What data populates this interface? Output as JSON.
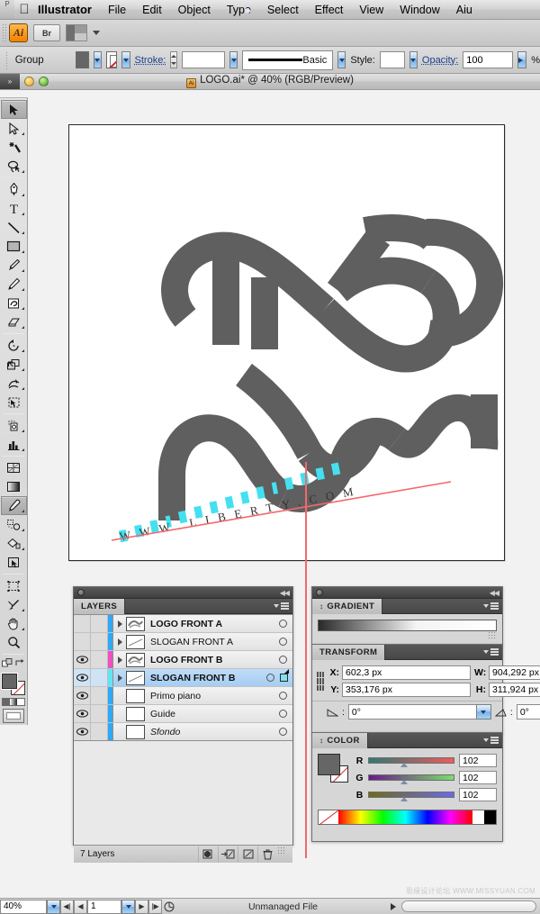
{
  "menubar": {
    "corner_label": "P",
    "apple_icon": "apple-logo",
    "items": [
      {
        "label": "Illustrator",
        "bold": true
      },
      {
        "label": "File"
      },
      {
        "label": "Edit"
      },
      {
        "label": "Object"
      },
      {
        "label": "Type"
      },
      {
        "label": "Select"
      },
      {
        "label": "Effect"
      },
      {
        "label": "View"
      },
      {
        "label": "Window"
      },
      {
        "label": "Aiu"
      }
    ]
  },
  "approw": {
    "ai_badge": "Ai",
    "bridge_label": "Br",
    "arrange_icon": "arrange-documents-icon",
    "dropdown_icon": "chevron-down-icon"
  },
  "controlbar": {
    "selection_label": "Group",
    "fill_swatch_color": "#666666",
    "stroke_label": "Stroke:",
    "stroke_weight": "",
    "stroke_profile": "Basic",
    "style_label": "Style:",
    "opacity_label": "Opacity:",
    "opacity_value": "100",
    "opacity_unit": "%"
  },
  "titlebar": {
    "title": "LOGO.ai* @ 40% (RGB/Preview)",
    "doc_icon": "Ai",
    "close_button": "yellow-minimize-dot",
    "zoom_button": "green-zoom-dot"
  },
  "toolbox": {
    "tools": [
      {
        "name": "selection-tool",
        "selected": true
      },
      {
        "name": "direct-selection-tool",
        "selected": false
      },
      {
        "name": "magic-wand-tool",
        "selected": false
      },
      {
        "name": "lasso-tool",
        "selected": false
      },
      {
        "name": "pen-tool",
        "selected": false
      },
      {
        "name": "type-tool",
        "selected": false
      },
      {
        "name": "line-segment-tool",
        "selected": false
      },
      {
        "name": "rectangle-tool",
        "selected": false
      },
      {
        "name": "paintbrush-tool",
        "selected": false
      },
      {
        "name": "pencil-tool",
        "selected": false
      },
      {
        "name": "blob-brush-tool",
        "selected": false
      },
      {
        "name": "eraser-tool",
        "selected": false
      },
      {
        "name": "rotate-tool",
        "selected": false
      },
      {
        "name": "scale-tool",
        "selected": false
      },
      {
        "name": "warp-tool",
        "selected": false
      },
      {
        "name": "free-transform-tool",
        "selected": false
      },
      {
        "name": "symbol-sprayer-tool",
        "selected": false
      },
      {
        "name": "column-graph-tool",
        "selected": false
      },
      {
        "name": "mesh-tool",
        "selected": false
      },
      {
        "name": "gradient-tool",
        "selected": false
      },
      {
        "name": "eyedropper-tool",
        "selected": true
      },
      {
        "name": "blend-tool",
        "selected": false
      },
      {
        "name": "live-paint-bucket-tool",
        "selected": false
      },
      {
        "name": "live-paint-selection-tool",
        "selected": false
      },
      {
        "name": "artboard-tool",
        "selected": false
      },
      {
        "name": "slice-tool",
        "selected": false
      },
      {
        "name": "hand-tool",
        "selected": false
      },
      {
        "name": "zoom-tool",
        "selected": false
      }
    ],
    "fill_color": "#666666",
    "stroke_color": "none"
  },
  "canvas": {
    "logo": {
      "color": "#5f5f5f",
      "slogan_highlight_color": "#45e0f0",
      "guide_color": "#f2686b",
      "alt_text": "Interlocking ribbon knot logo with slanted slogan baseline"
    }
  },
  "layers_panel": {
    "tab_label": "LAYERS",
    "rows": [
      {
        "name": "LOGO FRONT A",
        "visible": false,
        "locked": false,
        "color": "#2fa8f5",
        "expandable": true,
        "selected": false,
        "italic": false,
        "thumb": "artwork"
      },
      {
        "name": "SLOGAN FRONT A",
        "visible": false,
        "locked": false,
        "color": "#2fa8f5",
        "expandable": true,
        "selected": false,
        "italic": false,
        "thumb": "line"
      },
      {
        "name": "LOGO FRONT B",
        "visible": true,
        "locked": false,
        "color": "#f050c0",
        "expandable": true,
        "selected": false,
        "italic": false,
        "thumb": "artwork"
      },
      {
        "name": "SLOGAN FRONT B",
        "visible": true,
        "locked": false,
        "color": "#5fe6f2",
        "expandable": true,
        "selected": true,
        "italic": false,
        "thumb": "line"
      },
      {
        "name": "Primo piano",
        "visible": true,
        "locked": false,
        "color": "#2fa8f5",
        "expandable": false,
        "selected": false,
        "italic": false,
        "thumb": "blank"
      },
      {
        "name": "Guide",
        "visible": true,
        "locked": false,
        "color": "#2fa8f5",
        "expandable": false,
        "selected": false,
        "italic": false,
        "thumb": "blank"
      },
      {
        "name": "Sfondo",
        "visible": true,
        "locked": false,
        "color": "#2fa8f5",
        "expandable": false,
        "selected": false,
        "italic": true,
        "thumb": "blank"
      }
    ],
    "footer_count": "7 Layers",
    "footer_buttons": [
      {
        "name": "make-clipping-mask-button"
      },
      {
        "name": "create-new-sublayer-button"
      },
      {
        "name": "create-new-layer-button"
      },
      {
        "name": "delete-layer-button"
      }
    ]
  },
  "gradient_panel": {
    "tab_label": "GRADIENT",
    "ramp_from": "#2a2a2a",
    "ramp_to": "#ffffff"
  },
  "transform_panel": {
    "tab_label": "TRANSFORM",
    "reference_point": "center",
    "fields": {
      "x_label": "X:",
      "x_value": "602,3 px",
      "y_label": "Y:",
      "y_value": "353,176 px",
      "w_label": "W:",
      "w_value": "904,292 px",
      "h_label": "H:",
      "h_value": "311,924 px"
    },
    "rotate_label": "rotate-angle-icon",
    "rotate_value": "0°",
    "shear_label": "shear-angle-icon",
    "shear_value": "0°",
    "constrain_icon": "link-chain-icon"
  },
  "color_panel": {
    "tab_label": "COLOR",
    "fill_color": "#666666",
    "stroke_color": "none",
    "channels": [
      {
        "label": "R",
        "value": "102",
        "from": "#2e7a72",
        "to": "#f05a5a"
      },
      {
        "label": "G",
        "value": "102",
        "from": "#6a1a8a",
        "to": "#78e06a"
      },
      {
        "label": "B",
        "value": "102",
        "from": "#706a18",
        "to": "#6a6ae8"
      }
    ],
    "spectrum_icon": "color-spectrum-ramp"
  },
  "statusbar": {
    "zoom_value": "40%",
    "first_page_icon": "first-page-icon",
    "prev_page_icon": "prev-page-icon",
    "page_value": "1",
    "next_page_icon": "next-page-icon",
    "last_page_icon": "last-page-icon",
    "artboard_nav_icon": "artboard-navigation-icon",
    "status_text": "Unmanaged File",
    "expand_icon": "play-triangle-icon"
  },
  "watermark": {
    "text": "思缘设计论坛  WWW.MISSYUAN.COM"
  }
}
